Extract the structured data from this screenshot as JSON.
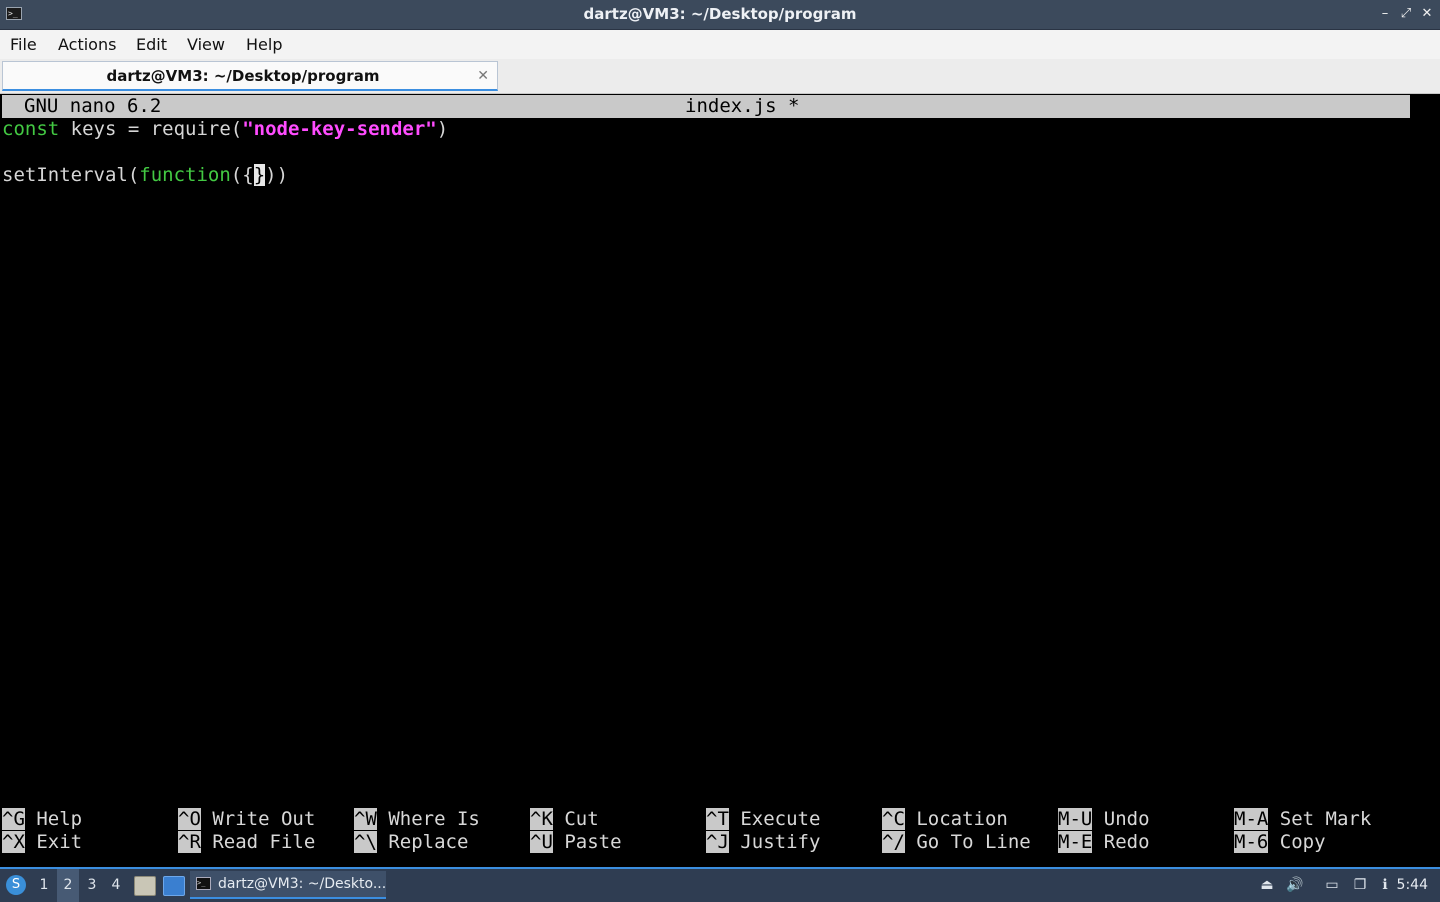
{
  "window": {
    "title": "dartz@VM3: ~/Desktop/program",
    "controls": {
      "minimize": "–",
      "maximize": "⤢",
      "close": "✕"
    }
  },
  "menubar": {
    "items": [
      "File",
      "Actions",
      "Edit",
      "View",
      "Help"
    ]
  },
  "tab": {
    "label": "dartz@VM3: ~/Desktop/program",
    "close": "✕"
  },
  "nano": {
    "version": "GNU nano 6.2",
    "filename": "index.js *",
    "lines": [
      {
        "kw": "const",
        "rest1": " keys = require(",
        "str": "\"node-key-sender\"",
        "rest2": ")"
      },
      {},
      {
        "pre": "setInterval(",
        "kw": "function",
        "mid": "({",
        "cursor": "}",
        "post": "))"
      }
    ],
    "shortcuts": [
      {
        "key": "^G",
        "label": "Help"
      },
      {
        "key": "^X",
        "label": "Exit"
      },
      {
        "key": "^O",
        "label": "Write Out"
      },
      {
        "key": "^R",
        "label": "Read File"
      },
      {
        "key": "^W",
        "label": "Where Is"
      },
      {
        "key": "^\\",
        "label": "Replace"
      },
      {
        "key": "^K",
        "label": "Cut"
      },
      {
        "key": "^U",
        "label": "Paste"
      },
      {
        "key": "^T",
        "label": "Execute"
      },
      {
        "key": "^J",
        "label": "Justify"
      },
      {
        "key": "^C",
        "label": "Location"
      },
      {
        "key": "^/",
        "label": "Go To Line"
      },
      {
        "key": "M-U",
        "label": "Undo"
      },
      {
        "key": "M-E",
        "label": "Redo"
      },
      {
        "key": "M-A",
        "label": "Set Mark"
      },
      {
        "key": "M-6",
        "label": "Copy"
      }
    ]
  },
  "taskbar": {
    "desktops": [
      "1",
      "2",
      "3",
      "4"
    ],
    "active_desktop": "2",
    "task_label": "dartz@VM3: ~/Deskto...",
    "clock": "5:44"
  },
  "colors": {
    "keyword": "#43c943",
    "string": "#ff4cff",
    "accent": "#3b8ee0"
  }
}
